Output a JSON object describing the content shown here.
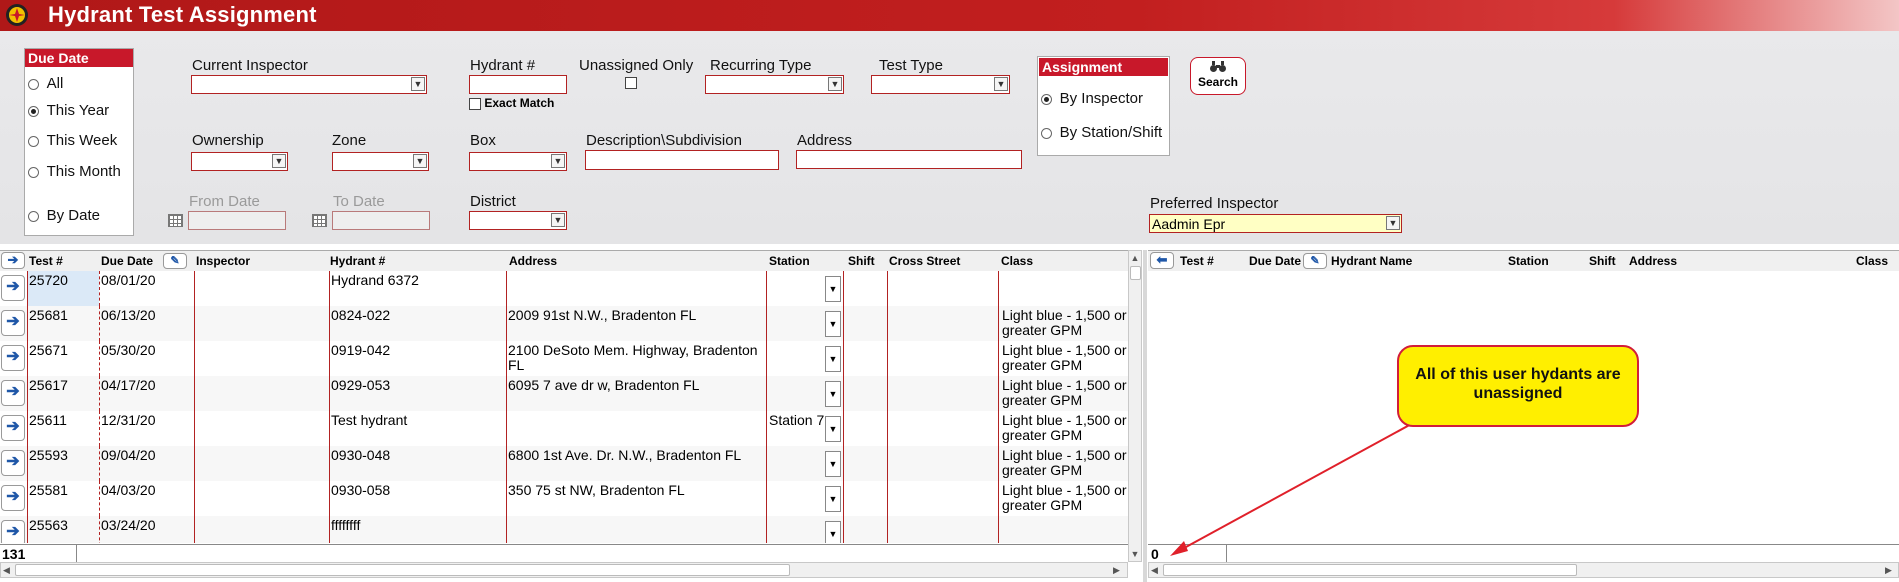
{
  "window": {
    "title": "Hydrant Test Assignment"
  },
  "due_date": {
    "header": "Due Date",
    "options": [
      {
        "label": "All",
        "selected": false
      },
      {
        "label": "This Year",
        "selected": true
      },
      {
        "label": "This Week",
        "selected": false
      },
      {
        "label": "This Month",
        "selected": false
      },
      {
        "label": "By Date",
        "selected": false
      }
    ]
  },
  "filters": {
    "current_inspector": {
      "label": "Current Inspector",
      "value": ""
    },
    "hydrant_no": {
      "label": "Hydrant #",
      "value": ""
    },
    "exact_match": {
      "label": "Exact Match",
      "checked": false
    },
    "unassigned_only": {
      "label": "Unassigned Only",
      "checked": false
    },
    "recurring_type": {
      "label": "Recurring Type",
      "value": ""
    },
    "test_type": {
      "label": "Test Type",
      "value": ""
    },
    "ownership": {
      "label": "Ownership",
      "value": ""
    },
    "zone": {
      "label": "Zone",
      "value": ""
    },
    "box": {
      "label": "Box",
      "value": ""
    },
    "description": {
      "label": "Description\\Subdivision",
      "value": ""
    },
    "address": {
      "label": "Address",
      "value": ""
    },
    "from_date": {
      "label": "From Date",
      "value": ""
    },
    "to_date": {
      "label": "To Date",
      "value": ""
    },
    "district": {
      "label": "District",
      "value": ""
    },
    "preferred_inspector": {
      "label": "Preferred Inspector",
      "value": "Aadmin Epr"
    }
  },
  "assignment": {
    "header": "Assignment",
    "options": [
      {
        "label": "By Inspector",
        "selected": true
      },
      {
        "label": "By Station/Shift",
        "selected": false
      }
    ]
  },
  "search_button": {
    "label": "Search",
    "icon": "binoculars-icon"
  },
  "left_table": {
    "columns": [
      "Test #",
      "Due Date",
      "Inspector",
      "Hydrant #",
      "Address",
      "Station",
      "Shift",
      "Cross Street",
      "Class"
    ],
    "rows": [
      {
        "test": "25720",
        "due": "08/01/20",
        "inspector": "",
        "hydrant": "Hydrand 6372",
        "address": "",
        "station": "",
        "shift": "",
        "cross": "",
        "class": ""
      },
      {
        "test": "25681",
        "due": "06/13/20",
        "inspector": "",
        "hydrant": "0824-022",
        "address": "2009 91st  N.W., Bradenton FL",
        "station": "",
        "shift": "",
        "cross": "",
        "class": "Light blue - 1,500 or greater GPM"
      },
      {
        "test": "25671",
        "due": "05/30/20",
        "inspector": "",
        "hydrant": "0919-042",
        "address": "2100 DeSoto Mem. Highway, Bradenton FL",
        "station": "",
        "shift": "",
        "cross": "",
        "class": "Light blue - 1,500 or greater GPM"
      },
      {
        "test": "25617",
        "due": "04/17/20",
        "inspector": "",
        "hydrant": "0929-053",
        "address": "6095 7 ave dr w, Bradenton FL",
        "station": "",
        "shift": "",
        "cross": "",
        "class": "Light blue - 1,500 or greater GPM"
      },
      {
        "test": "25611",
        "due": "12/31/20",
        "inspector": "",
        "hydrant": "Test hydrant",
        "address": "",
        "station": "Station 7",
        "shift": "",
        "cross": "",
        "class": "Light blue - 1,500 or greater GPM"
      },
      {
        "test": "25593",
        "due": "09/04/20",
        "inspector": "",
        "hydrant": "0930-048",
        "address": "6800 1st Ave. Dr. N.W., Bradenton FL",
        "station": "",
        "shift": "",
        "cross": "",
        "class": "Light blue - 1,500 or greater GPM"
      },
      {
        "test": "25581",
        "due": "04/03/20",
        "inspector": "",
        "hydrant": "0930-058",
        "address": "350 75 st NW, Bradenton FL",
        "station": "",
        "shift": "",
        "cross": "",
        "class": "Light blue - 1,500 or greater GPM"
      },
      {
        "test": "25563",
        "due": "03/24/20",
        "inspector": "",
        "hydrant": "ffffffff",
        "address": "",
        "station": "",
        "shift": "",
        "cross": "",
        "class": ""
      }
    ],
    "count": "131"
  },
  "right_table": {
    "columns": [
      "Test #",
      "Due Date",
      "Hydrant Name",
      "Station",
      "Shift",
      "Address",
      "Class"
    ],
    "rows": [],
    "count": "0"
  },
  "callout": {
    "text": "All of this user hydants are unassigned"
  },
  "colors": {
    "accent": "#c8182a",
    "callout_fill": "#ffef00",
    "link_blue": "#1f57a8"
  }
}
